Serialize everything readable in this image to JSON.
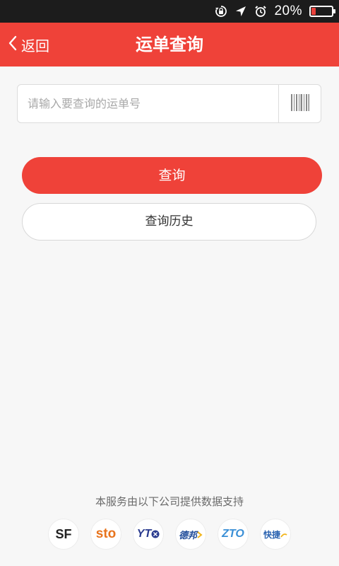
{
  "status_bar": {
    "battery_percent_text": "20%",
    "battery_level": 0.2,
    "icons": [
      "orientation-lock-icon",
      "location-arrow-icon",
      "alarm-clock-icon"
    ]
  },
  "nav": {
    "back_label": "返回",
    "title": "运单查询"
  },
  "search": {
    "placeholder": "请输入要查询的运单号",
    "value": "",
    "scan_icon": "barcode-icon"
  },
  "buttons": {
    "query_label": "查询",
    "history_label": "查询历史"
  },
  "footer": {
    "support_text": "本服务由以下公司提供数据支持",
    "carriers": [
      {
        "logo_text": "SF",
        "color": "#222222"
      },
      {
        "logo_text": "sto",
        "color": "#e8741d"
      },
      {
        "logo_text": "YT",
        "color": "#2b3c8f"
      },
      {
        "logo_text": "德邦",
        "color": "#1f4b9a"
      },
      {
        "logo_text": "ZTO",
        "color": "#3a8fd6"
      },
      {
        "logo_text": "快捷",
        "color": "#2a62b0"
      }
    ]
  },
  "colors": {
    "accent": "#ef4239",
    "status_bar": "#1c1c1c",
    "background": "#f7f7f7"
  }
}
